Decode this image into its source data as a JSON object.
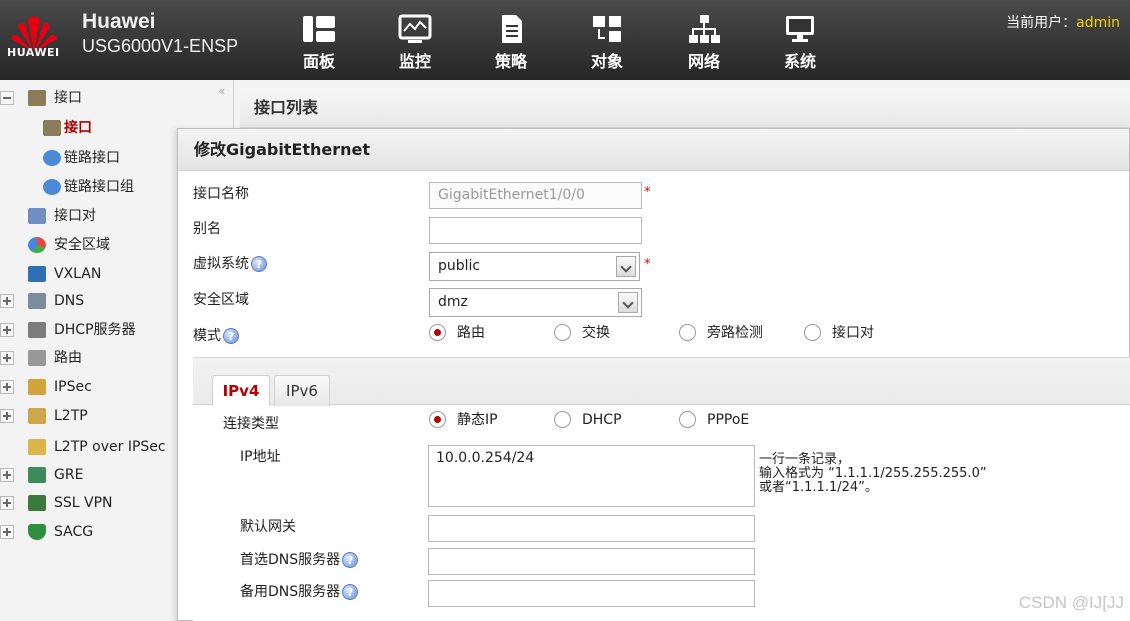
{
  "header": {
    "brand": "Huawei",
    "device": "USG6000V1-ENSP",
    "logo_text": "HUAWEI",
    "nav": [
      {
        "label": "面板",
        "icon": "dashboard-icon"
      },
      {
        "label": "监控",
        "icon": "monitor-icon"
      },
      {
        "label": "策略",
        "icon": "policy-icon"
      },
      {
        "label": "对象",
        "icon": "object-icon"
      },
      {
        "label": "网络",
        "icon": "network-icon"
      },
      {
        "label": "系统",
        "icon": "system-icon"
      }
    ],
    "user_label": "当前用户：",
    "user_name": "admin"
  },
  "sidebar": {
    "collapse_glyph": "«",
    "items": [
      {
        "label": "接口",
        "icon": "interface-icon",
        "expander": "minus"
      },
      {
        "label": "接口",
        "icon": "interface-icon",
        "active": true
      },
      {
        "label": "链路接口",
        "icon": "link-interface-icon"
      },
      {
        "label": "链路接口组",
        "icon": "link-group-icon"
      },
      {
        "label": "接口对",
        "icon": "interface-pair-icon"
      },
      {
        "label": "安全区域",
        "icon": "security-zone-icon"
      },
      {
        "label": "VXLAN",
        "icon": "vxlan-icon"
      },
      {
        "label": "DNS",
        "icon": "dns-icon",
        "expander": "plus"
      },
      {
        "label": "DHCP服务器",
        "icon": "dhcp-icon",
        "expander": "plus"
      },
      {
        "label": "路由",
        "icon": "route-icon",
        "expander": "plus"
      },
      {
        "label": "IPSec",
        "icon": "ipsec-icon",
        "expander": "plus"
      },
      {
        "label": "L2TP",
        "icon": "l2tp-icon",
        "expander": "plus"
      },
      {
        "label": "L2TP over IPSec",
        "icon": "l2tp-ipsec-icon"
      },
      {
        "label": "GRE",
        "icon": "gre-icon",
        "expander": "plus"
      },
      {
        "label": "SSL VPN",
        "icon": "ssl-vpn-icon",
        "expander": "plus"
      },
      {
        "label": "SACG",
        "icon": "sacg-icon",
        "expander": "plus"
      }
    ]
  },
  "main": {
    "title": "接口列表"
  },
  "dialog": {
    "title": "修改GigabitEthernet",
    "required_mark": "*",
    "help_glyph": "?",
    "fields": {
      "name_label": "接口名称",
      "name_value": "GigabitEthernet1/0/0",
      "alias_label": "别名",
      "alias_value": "",
      "vsys_label": "虚拟系统",
      "vsys_value": "public",
      "zone_label": "安全区域",
      "zone_value": "dmz",
      "mode_label": "模式",
      "mode_options": [
        "路由",
        "交换",
        "旁路检测",
        "接口对"
      ],
      "mode_selected": "路由"
    },
    "tabs": [
      "IPv4",
      "IPv6"
    ],
    "active_tab": "IPv4",
    "ipv4": {
      "conn_type_label": "连接类型",
      "conn_options": [
        "静态IP",
        "DHCP",
        "PPPoE"
      ],
      "conn_selected": "静态IP",
      "ip_label": "IP地址",
      "ip_value": "10.0.0.254/24",
      "ip_hint": [
        "一行一条记录，",
        "输入格式为 “1.1.1.1/255.255.255.0”",
        "或者“1.1.1.1/24”。"
      ],
      "gateway_label": "默认网关",
      "gateway_value": "",
      "dns1_label": "首选DNS服务器",
      "dns1_value": "",
      "dns2_label": "备用DNS服务器",
      "dns2_value": ""
    }
  },
  "watermark": "CSDN @IJ[JJ",
  "colors": {
    "header_bg": "#262626",
    "active_red": "#b40000",
    "user_yellow": "#f6d000",
    "required_red": "#e00000"
  }
}
